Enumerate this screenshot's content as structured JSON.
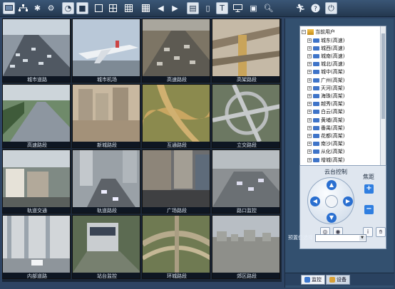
{
  "toolbar": {
    "icons": [
      "monitor-icon",
      "network-icon",
      "settings-gear-icon",
      "gear-icon",
      "clock-icon",
      "stop-icon",
      "layout-1-icon",
      "layout-4-icon",
      "layout-9-icon",
      "prev-icon",
      "next-icon",
      "document-icon",
      "mobile-icon",
      "text-icon",
      "display-icon",
      "zoom-icon",
      "search-icon",
      "run-icon",
      "help-icon",
      "exit-icon"
    ]
  },
  "video_wall": {
    "cameras": [
      {
        "caption": "城市道路"
      },
      {
        "caption": "城市机场"
      },
      {
        "caption": "高速路段"
      },
      {
        "caption": "高架路段"
      },
      {
        "caption": "高速路段"
      },
      {
        "caption": "新城路段"
      },
      {
        "caption": "互通路段"
      },
      {
        "caption": "立交路段"
      },
      {
        "caption": "轨道交通"
      },
      {
        "caption": "轨道路段"
      },
      {
        "caption": "广场路段"
      },
      {
        "caption": "路口监控"
      },
      {
        "caption": "内部道路"
      },
      {
        "caption": "站台监控"
      },
      {
        "caption": "环城路段"
      },
      {
        "caption": "郊区路段"
      }
    ]
  },
  "device_tree": {
    "root": "当前用户",
    "items": [
      "城东(高速)",
      "城西(高速)",
      "城南(高速)",
      "城北(高速)",
      "城中(高架)",
      "广州(高架)",
      "天河(高架)",
      "海珠(高架)",
      "越秀(高架)",
      "白云(高架)",
      "黄埔(高架)",
      "番禺(高架)",
      "花都(高架)",
      "南沙(高架)",
      "从化(高架)",
      "增城(高架)"
    ]
  },
  "ptz": {
    "title": "云台控制",
    "zoom_label": "焦距",
    "zoom_in": "+",
    "zoom_out": "−",
    "preset_label": "预置位选择",
    "preset_value": ""
  },
  "tabs": [
    {
      "label": "监控"
    },
    {
      "label": "设备"
    }
  ],
  "colors": {
    "accent": "#2a6fd0",
    "background": "#2e4463",
    "tree_bg": "#ffffff"
  }
}
